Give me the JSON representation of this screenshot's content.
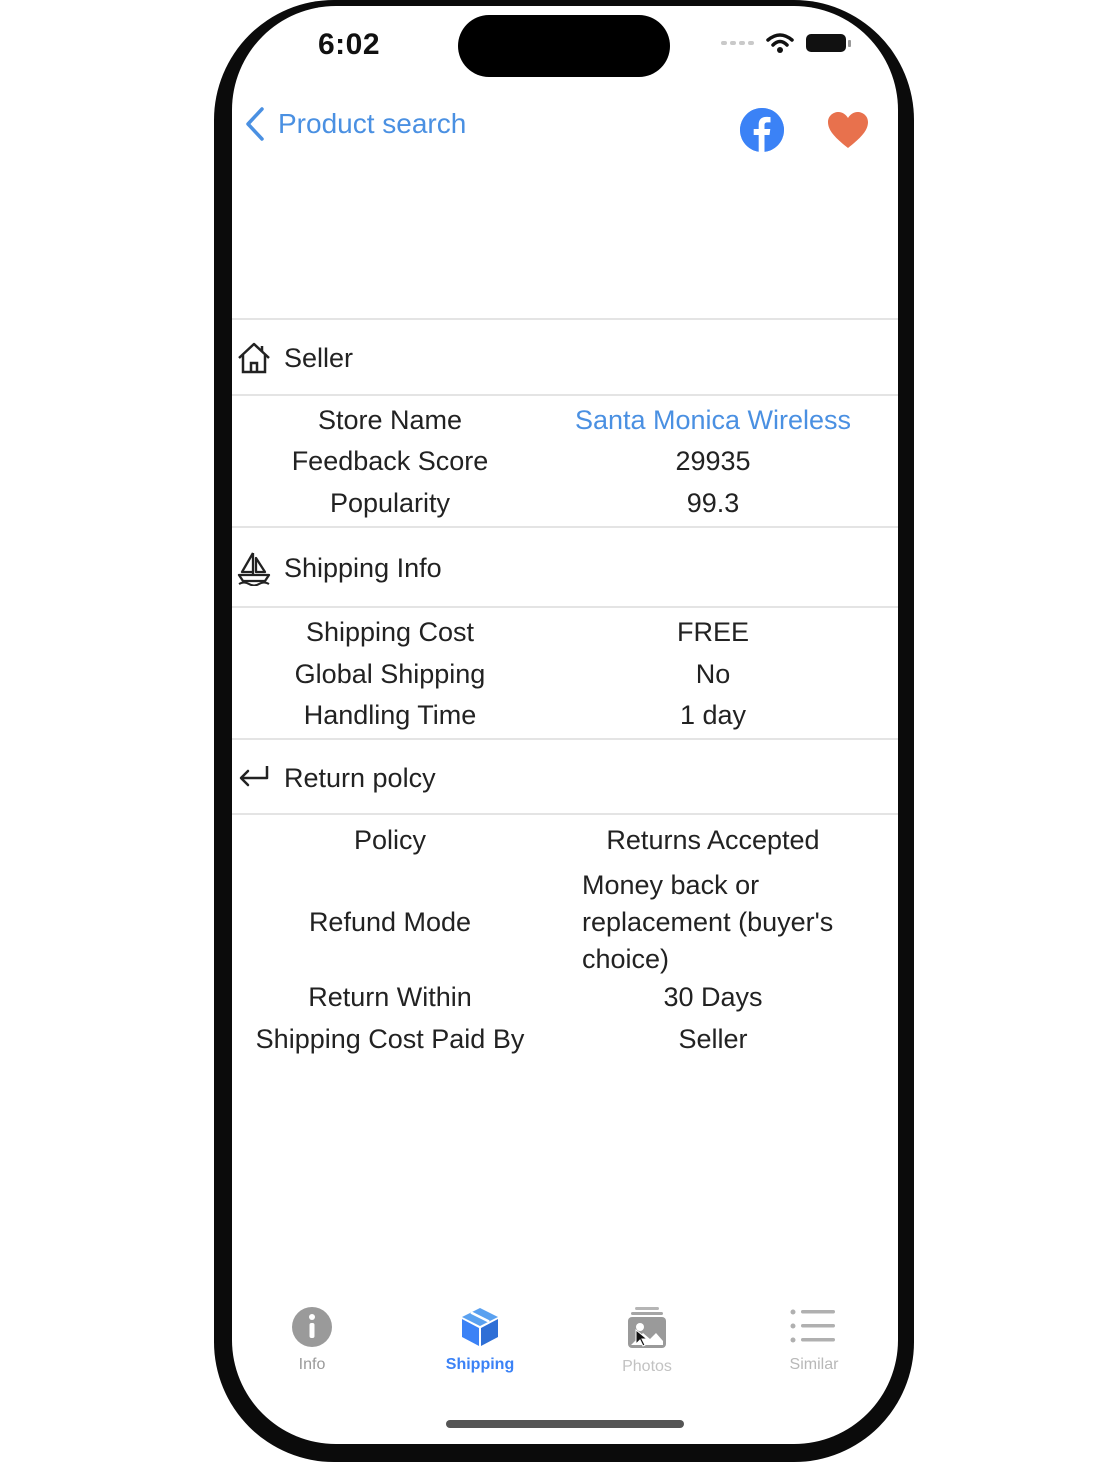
{
  "status_bar": {
    "time": "6:02"
  },
  "nav": {
    "back_label": "Product search",
    "share_icon": "facebook-icon",
    "favorite_icon": "heart-icon",
    "colors": {
      "accent": "#4a90e2",
      "heart": "#e8714d",
      "facebook": "#3b82f6"
    }
  },
  "seller": {
    "header": "Seller",
    "rows": [
      {
        "label": "Store Name",
        "value": "Santa Monica Wireless"
      },
      {
        "label": "Feedback Score",
        "value": "29935"
      },
      {
        "label": "Popularity",
        "value": "99.3"
      }
    ]
  },
  "shipping": {
    "header": "Shipping Info",
    "rows": [
      {
        "label": "Shipping Cost",
        "value": "FREE"
      },
      {
        "label": "Global Shipping",
        "value": "No"
      },
      {
        "label": "Handling Time",
        "value": "1 day"
      }
    ]
  },
  "returns": {
    "header": "Return polcy",
    "rows": [
      {
        "label": "Policy",
        "value": "Returns Accepted"
      },
      {
        "label": "Refund Mode",
        "value": "Money back or replacement (buyer's choice)"
      },
      {
        "label": "Return Within",
        "value": "30 Days"
      },
      {
        "label": "Shipping Cost Paid By",
        "value": "Seller"
      }
    ]
  },
  "tabs": [
    {
      "label": "Info",
      "icon": "info-icon",
      "active": false
    },
    {
      "label": "Shipping",
      "icon": "box-icon",
      "active": true
    },
    {
      "label": "Photos",
      "icon": "photos-icon",
      "active": false
    },
    {
      "label": "Similar",
      "icon": "list-icon",
      "active": false
    }
  ]
}
